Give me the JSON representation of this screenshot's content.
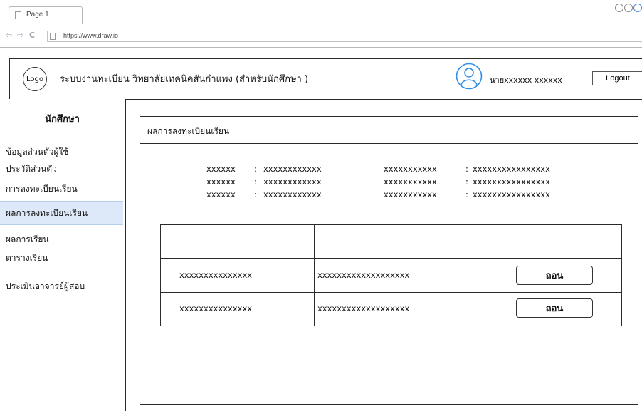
{
  "browser": {
    "tab_title": "Page 1",
    "url": "https://www.draw.io"
  },
  "header": {
    "logo": "Logo",
    "title": "ระบบงานทะเบียน วิทยาลัยเทคนิคสันกำแพง (สำหรับนักศึกษา )",
    "user_name": "นายxxxxxx xxxxxx",
    "logout_label": "Logout"
  },
  "sidebar": {
    "title": "นักศึกษา",
    "items": [
      {
        "label": "ข้อมูลส่วนตัวผู้ใช้"
      },
      {
        "label": "ประวัติส่วนตัว"
      },
      {
        "label": "การลงทะเบียนเรียน"
      },
      {
        "label": "ผลการลงทะเบียนเรียน"
      },
      {
        "label": "ผลการเรียน"
      },
      {
        "label": "ตารางเรียน"
      },
      {
        "label": "ประเมินอาจารย์ผู้สอบ"
      }
    ]
  },
  "main": {
    "title": "ผลการลงทะเบียนเรียน",
    "info": [
      {
        "label1": "xxxxxx",
        "value1": "xxxxxxxxxxxx",
        "label2": "xxxxxxxxxxx",
        "value2": "xxxxxxxxxxxxxxxx"
      },
      {
        "label1": "xxxxxx",
        "value1": "xxxxxxxxxxxx",
        "label2": "xxxxxxxxxxx",
        "value2": "xxxxxxxxxxxxxxxx"
      },
      {
        "label1": "xxxxxx",
        "value1": "xxxxxxxxxxxx",
        "label2": "xxxxxxxxxxx",
        "value2": "xxxxxxxxxxxxxxxx"
      }
    ],
    "separator": ":",
    "table": {
      "headers": [
        "",
        "",
        ""
      ],
      "rows": [
        {
          "col1": "xxxxxxxxxxxxxxx",
          "col2": "xxxxxxxxxxxxxxxxxxx",
          "action": "ถอน"
        },
        {
          "col1": "xxxxxxxxxxxxxxx",
          "col2": "xxxxxxxxxxxxxxxxxxx",
          "action": "ถอน"
        }
      ]
    }
  },
  "colors": {
    "active_item_bg": "#dde9f8",
    "user_icon": "#2f8fe8",
    "border": "#2b2b2b"
  }
}
